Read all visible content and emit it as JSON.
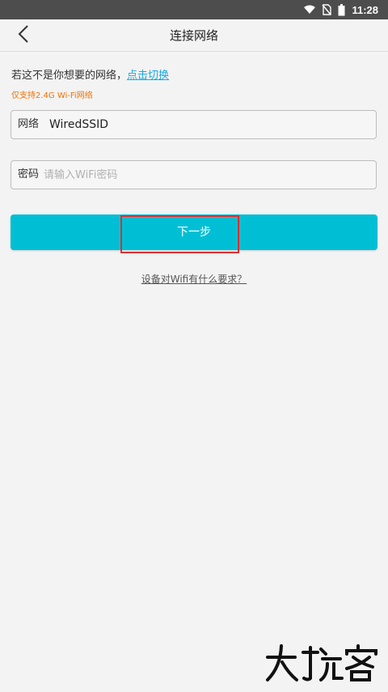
{
  "status_bar": {
    "time": "11:28"
  },
  "nav": {
    "title": "连接网络"
  },
  "hint": {
    "text": "若这不是你想要的网络，",
    "switch_link": "点击切换"
  },
  "note": "仅支持2.4G Wi-Fi网络",
  "network_field": {
    "label": "网络",
    "value": "WiredSSID"
  },
  "password_field": {
    "label": "密码",
    "placeholder": "请输入WiFi密码"
  },
  "next_button": "下一步",
  "requirement_link": "设备对Wifi有什么要求？",
  "colors": {
    "accent": "#00bfd5",
    "link": "#1aa7e0",
    "warning": "#ef7200",
    "highlight": "#e03030"
  }
}
